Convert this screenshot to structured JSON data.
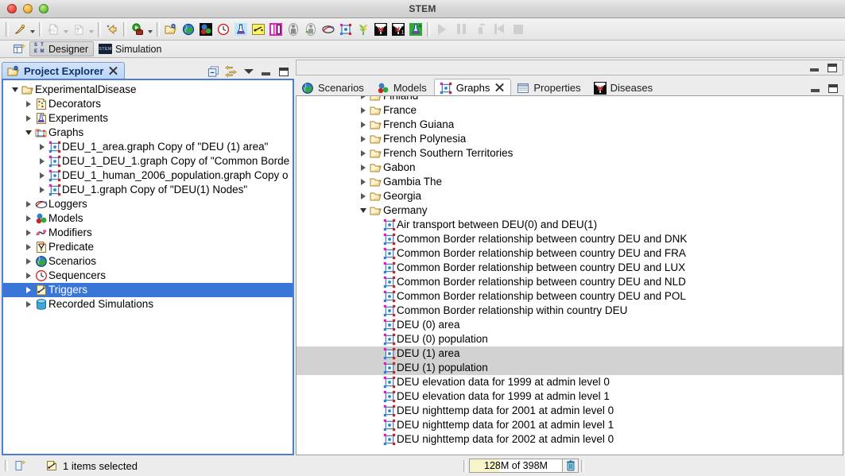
{
  "window": {
    "title": "STEM"
  },
  "toolbar": {
    "groups": [
      {
        "name": "new",
        "buttons": [
          {
            "icon": "new-wizard-icon",
            "label": "New",
            "dropdown": true,
            "enabled": true
          }
        ]
      },
      {
        "name": "import-export",
        "buttons": [
          {
            "icon": "import-icon",
            "label": "Import",
            "dropdown": true,
            "enabled": false
          },
          {
            "icon": "export-icon",
            "label": "Export",
            "dropdown": true,
            "enabled": false
          }
        ]
      },
      {
        "name": "undo",
        "buttons": [
          {
            "icon": "undo-icon",
            "label": "Undo",
            "dropdown": false,
            "enabled": true
          }
        ]
      },
      {
        "name": "run",
        "buttons": [
          {
            "icon": "run-scenario-icon",
            "label": "Run Scenario",
            "dropdown": true,
            "enabled": true
          }
        ]
      },
      {
        "name": "stem-wizards",
        "buttons": [
          {
            "icon": "open-project-icon",
            "label": "Open Project",
            "enabled": true
          },
          {
            "icon": "scenario-globe-icon",
            "label": "New Scenario",
            "enabled": true
          },
          {
            "icon": "model-icon",
            "label": "New Model",
            "enabled": true
          },
          {
            "icon": "sequencer-clock-icon",
            "label": "New Sequencer",
            "enabled": true
          },
          {
            "icon": "experiment-flask-icon",
            "label": "New Experiment",
            "enabled": true
          },
          {
            "icon": "trigger-icon",
            "label": "New Trigger",
            "enabled": true
          },
          {
            "icon": "predicate-icon",
            "label": "New Predicate",
            "enabled": true
          },
          {
            "icon": "population-model-icon",
            "label": "New Population Model",
            "enabled": true
          },
          {
            "icon": "population-initializer-icon",
            "label": "New Population Initializer",
            "enabled": true
          },
          {
            "icon": "logger-icon",
            "label": "New Logger",
            "enabled": true
          },
          {
            "icon": "graph-icon",
            "label": "New Graph",
            "enabled": true
          },
          {
            "icon": "food-production-icon",
            "label": "New Food Production",
            "enabled": true
          },
          {
            "icon": "disease-model-icon",
            "label": "New Disease Model",
            "enabled": true
          },
          {
            "icon": "disease-model-2-icon",
            "label": "New Disease Model Variant",
            "enabled": true
          },
          {
            "icon": "automatic-experiment-icon",
            "label": "New Automatic Experiment",
            "enabled": true
          }
        ]
      },
      {
        "name": "simulation-controls",
        "buttons": [
          {
            "icon": "play-icon",
            "label": "Run",
            "enabled": false
          },
          {
            "icon": "pause-icon",
            "label": "Pause",
            "enabled": false
          },
          {
            "icon": "step-icon",
            "label": "Step",
            "enabled": false
          },
          {
            "icon": "reset-icon",
            "label": "Reset",
            "enabled": false
          },
          {
            "icon": "stop-icon",
            "label": "Stop",
            "enabled": false
          }
        ]
      }
    ]
  },
  "perspective_bar": {
    "open_perspective_label": "Open Perspective",
    "items": [
      {
        "label": "Designer",
        "icon": "stem-designer-icon",
        "active": true
      },
      {
        "label": "Simulation",
        "icon": "stem-simulation-icon",
        "active": false
      }
    ]
  },
  "project_explorer": {
    "tab_label": "Project Explorer",
    "tab_icon": "project-explorer-icon",
    "tools": [
      {
        "name": "collapse-all",
        "label": "Collapse All"
      },
      {
        "name": "link-with-editor",
        "label": "Link with Editor"
      },
      {
        "name": "view-menu",
        "label": "View Menu"
      },
      {
        "name": "minimize",
        "label": "Minimize"
      },
      {
        "name": "maximize",
        "label": "Maximize"
      }
    ],
    "tree": [
      {
        "depth": 0,
        "twisty": "down",
        "icon": "project-folder-icon",
        "label": "ExperimentalDisease",
        "selected": false
      },
      {
        "depth": 1,
        "twisty": "right",
        "icon": "decorators-icon",
        "label": "Decorators",
        "selected": false
      },
      {
        "depth": 1,
        "twisty": "right",
        "icon": "experiment-flask-icon",
        "label": "Experiments",
        "selected": false
      },
      {
        "depth": 1,
        "twisty": "down",
        "icon": "graphs-folder-icon",
        "label": "Graphs",
        "selected": false
      },
      {
        "depth": 2,
        "twisty": "right",
        "icon": "graph-icon",
        "label": "DEU_1_area.graph Copy of \"DEU (1) area\"",
        "selected": false
      },
      {
        "depth": 2,
        "twisty": "right",
        "icon": "graph-icon",
        "label": "DEU_1_DEU_1.graph Copy of \"Common Border",
        "selected": false
      },
      {
        "depth": 2,
        "twisty": "right",
        "icon": "graph-icon",
        "label": "DEU_1_human_2006_population.graph Copy o",
        "selected": false
      },
      {
        "depth": 2,
        "twisty": "right",
        "icon": "graph-icon",
        "label": "DEU_1.graph Copy of \"DEU(1) Nodes\"",
        "selected": false
      },
      {
        "depth": 1,
        "twisty": "right",
        "icon": "logger-icon",
        "label": "Loggers",
        "selected": false
      },
      {
        "depth": 1,
        "twisty": "right",
        "icon": "model-icon",
        "label": "Models",
        "selected": false
      },
      {
        "depth": 1,
        "twisty": "right",
        "icon": "modifier-icon",
        "label": "Modifiers",
        "selected": false
      },
      {
        "depth": 1,
        "twisty": "right",
        "icon": "predicate-icon",
        "label": "Predicate",
        "selected": false
      },
      {
        "depth": 1,
        "twisty": "right",
        "icon": "scenario-globe-icon",
        "label": "Scenarios",
        "selected": false
      },
      {
        "depth": 1,
        "twisty": "right",
        "icon": "sequencer-clock-icon",
        "label": "Sequencers",
        "selected": false
      },
      {
        "depth": 1,
        "twisty": "right",
        "icon": "trigger-icon",
        "label": "Triggers",
        "selected": true
      },
      {
        "depth": 1,
        "twisty": "right",
        "icon": "recorded-sim-icon",
        "label": "Recorded Simulations",
        "selected": false
      }
    ]
  },
  "editor_area": {
    "tabs": [
      {
        "label": "Scenarios",
        "icon": "scenario-globe-icon",
        "active": false,
        "closeable": false
      },
      {
        "label": "Models",
        "icon": "model-icon",
        "active": false,
        "closeable": false
      },
      {
        "label": "Graphs",
        "icon": "graph-icon",
        "active": true,
        "closeable": true
      },
      {
        "label": "Properties",
        "icon": "properties-icon",
        "active": false,
        "closeable": false
      },
      {
        "label": "Diseases",
        "icon": "disease-model-icon",
        "active": false,
        "closeable": false
      }
    ],
    "tools": [
      {
        "name": "minimize",
        "label": "Minimize"
      },
      {
        "name": "maximize",
        "label": "Maximize"
      }
    ],
    "tree": [
      {
        "depth": 1,
        "twisty": "right",
        "icon": "folder-icon",
        "label": "Finland",
        "selected": false,
        "clipped": true
      },
      {
        "depth": 1,
        "twisty": "right",
        "icon": "folder-icon",
        "label": "France",
        "selected": false
      },
      {
        "depth": 1,
        "twisty": "right",
        "icon": "folder-icon",
        "label": "French Guiana",
        "selected": false
      },
      {
        "depth": 1,
        "twisty": "right",
        "icon": "folder-icon",
        "label": "French Polynesia",
        "selected": false
      },
      {
        "depth": 1,
        "twisty": "right",
        "icon": "folder-icon",
        "label": "French Southern Territories",
        "selected": false
      },
      {
        "depth": 1,
        "twisty": "right",
        "icon": "folder-icon",
        "label": "Gabon",
        "selected": false
      },
      {
        "depth": 1,
        "twisty": "right",
        "icon": "folder-icon",
        "label": "Gambia The",
        "selected": false
      },
      {
        "depth": 1,
        "twisty": "right",
        "icon": "folder-icon",
        "label": "Georgia",
        "selected": false
      },
      {
        "depth": 1,
        "twisty": "down",
        "icon": "folder-icon",
        "label": "Germany",
        "selected": false
      },
      {
        "depth": 2,
        "twisty": "none",
        "icon": "graph-icon",
        "label": "Air transport between DEU(0) and DEU(1)",
        "selected": false
      },
      {
        "depth": 2,
        "twisty": "none",
        "icon": "graph-icon",
        "label": "Common Border relationship between country DEU and DNK",
        "selected": false
      },
      {
        "depth": 2,
        "twisty": "none",
        "icon": "graph-icon",
        "label": "Common Border relationship between country DEU and FRA",
        "selected": false
      },
      {
        "depth": 2,
        "twisty": "none",
        "icon": "graph-icon",
        "label": "Common Border relationship between country DEU and LUX",
        "selected": false
      },
      {
        "depth": 2,
        "twisty": "none",
        "icon": "graph-icon",
        "label": "Common Border relationship between country DEU and NLD",
        "selected": false
      },
      {
        "depth": 2,
        "twisty": "none",
        "icon": "graph-icon",
        "label": "Common Border relationship between country DEU and POL",
        "selected": false
      },
      {
        "depth": 2,
        "twisty": "none",
        "icon": "graph-icon",
        "label": "Common Border relationship within country DEU",
        "selected": false
      },
      {
        "depth": 2,
        "twisty": "none",
        "icon": "graph-icon",
        "label": "DEU (0) area",
        "selected": false
      },
      {
        "depth": 2,
        "twisty": "none",
        "icon": "graph-icon",
        "label": "DEU (0) population",
        "selected": false
      },
      {
        "depth": 2,
        "twisty": "none",
        "icon": "graph-icon",
        "label": "DEU (1) area",
        "selected": true
      },
      {
        "depth": 2,
        "twisty": "none",
        "icon": "graph-icon",
        "label": "DEU (1) population",
        "selected": true
      },
      {
        "depth": 2,
        "twisty": "none",
        "icon": "graph-icon",
        "label": "DEU elevation data for 1999 at admin level 0",
        "selected": false
      },
      {
        "depth": 2,
        "twisty": "none",
        "icon": "graph-icon",
        "label": "DEU elevation data for 1999 at admin level 1",
        "selected": false
      },
      {
        "depth": 2,
        "twisty": "none",
        "icon": "graph-icon",
        "label": "DEU nighttemp data for 2001 at admin level 0",
        "selected": false
      },
      {
        "depth": 2,
        "twisty": "none",
        "icon": "graph-icon",
        "label": "DEU nighttemp data for 2001 at admin level 1",
        "selected": false
      },
      {
        "depth": 2,
        "twisty": "none",
        "icon": "graph-icon",
        "label": "DEU nighttemp data for 2002 at admin level 0",
        "selected": false,
        "clipped": true
      }
    ]
  },
  "status_bar": {
    "perspective_icon": "perspective-indicator-icon",
    "selection_icon": "trigger-icon",
    "selection_text": "1 items selected",
    "memory": {
      "text": "128M of 398M",
      "used_mb": 128,
      "total_mb": 398,
      "fill_color": "#f7f4c8",
      "trash_label": "Run Garbage Collector"
    }
  },
  "colors": {
    "selection_blue": "#3a76d8",
    "selection_gray": "#d2d2d2",
    "view_tab_active": "#bad4f6",
    "part_border": "#4a7fd4"
  }
}
